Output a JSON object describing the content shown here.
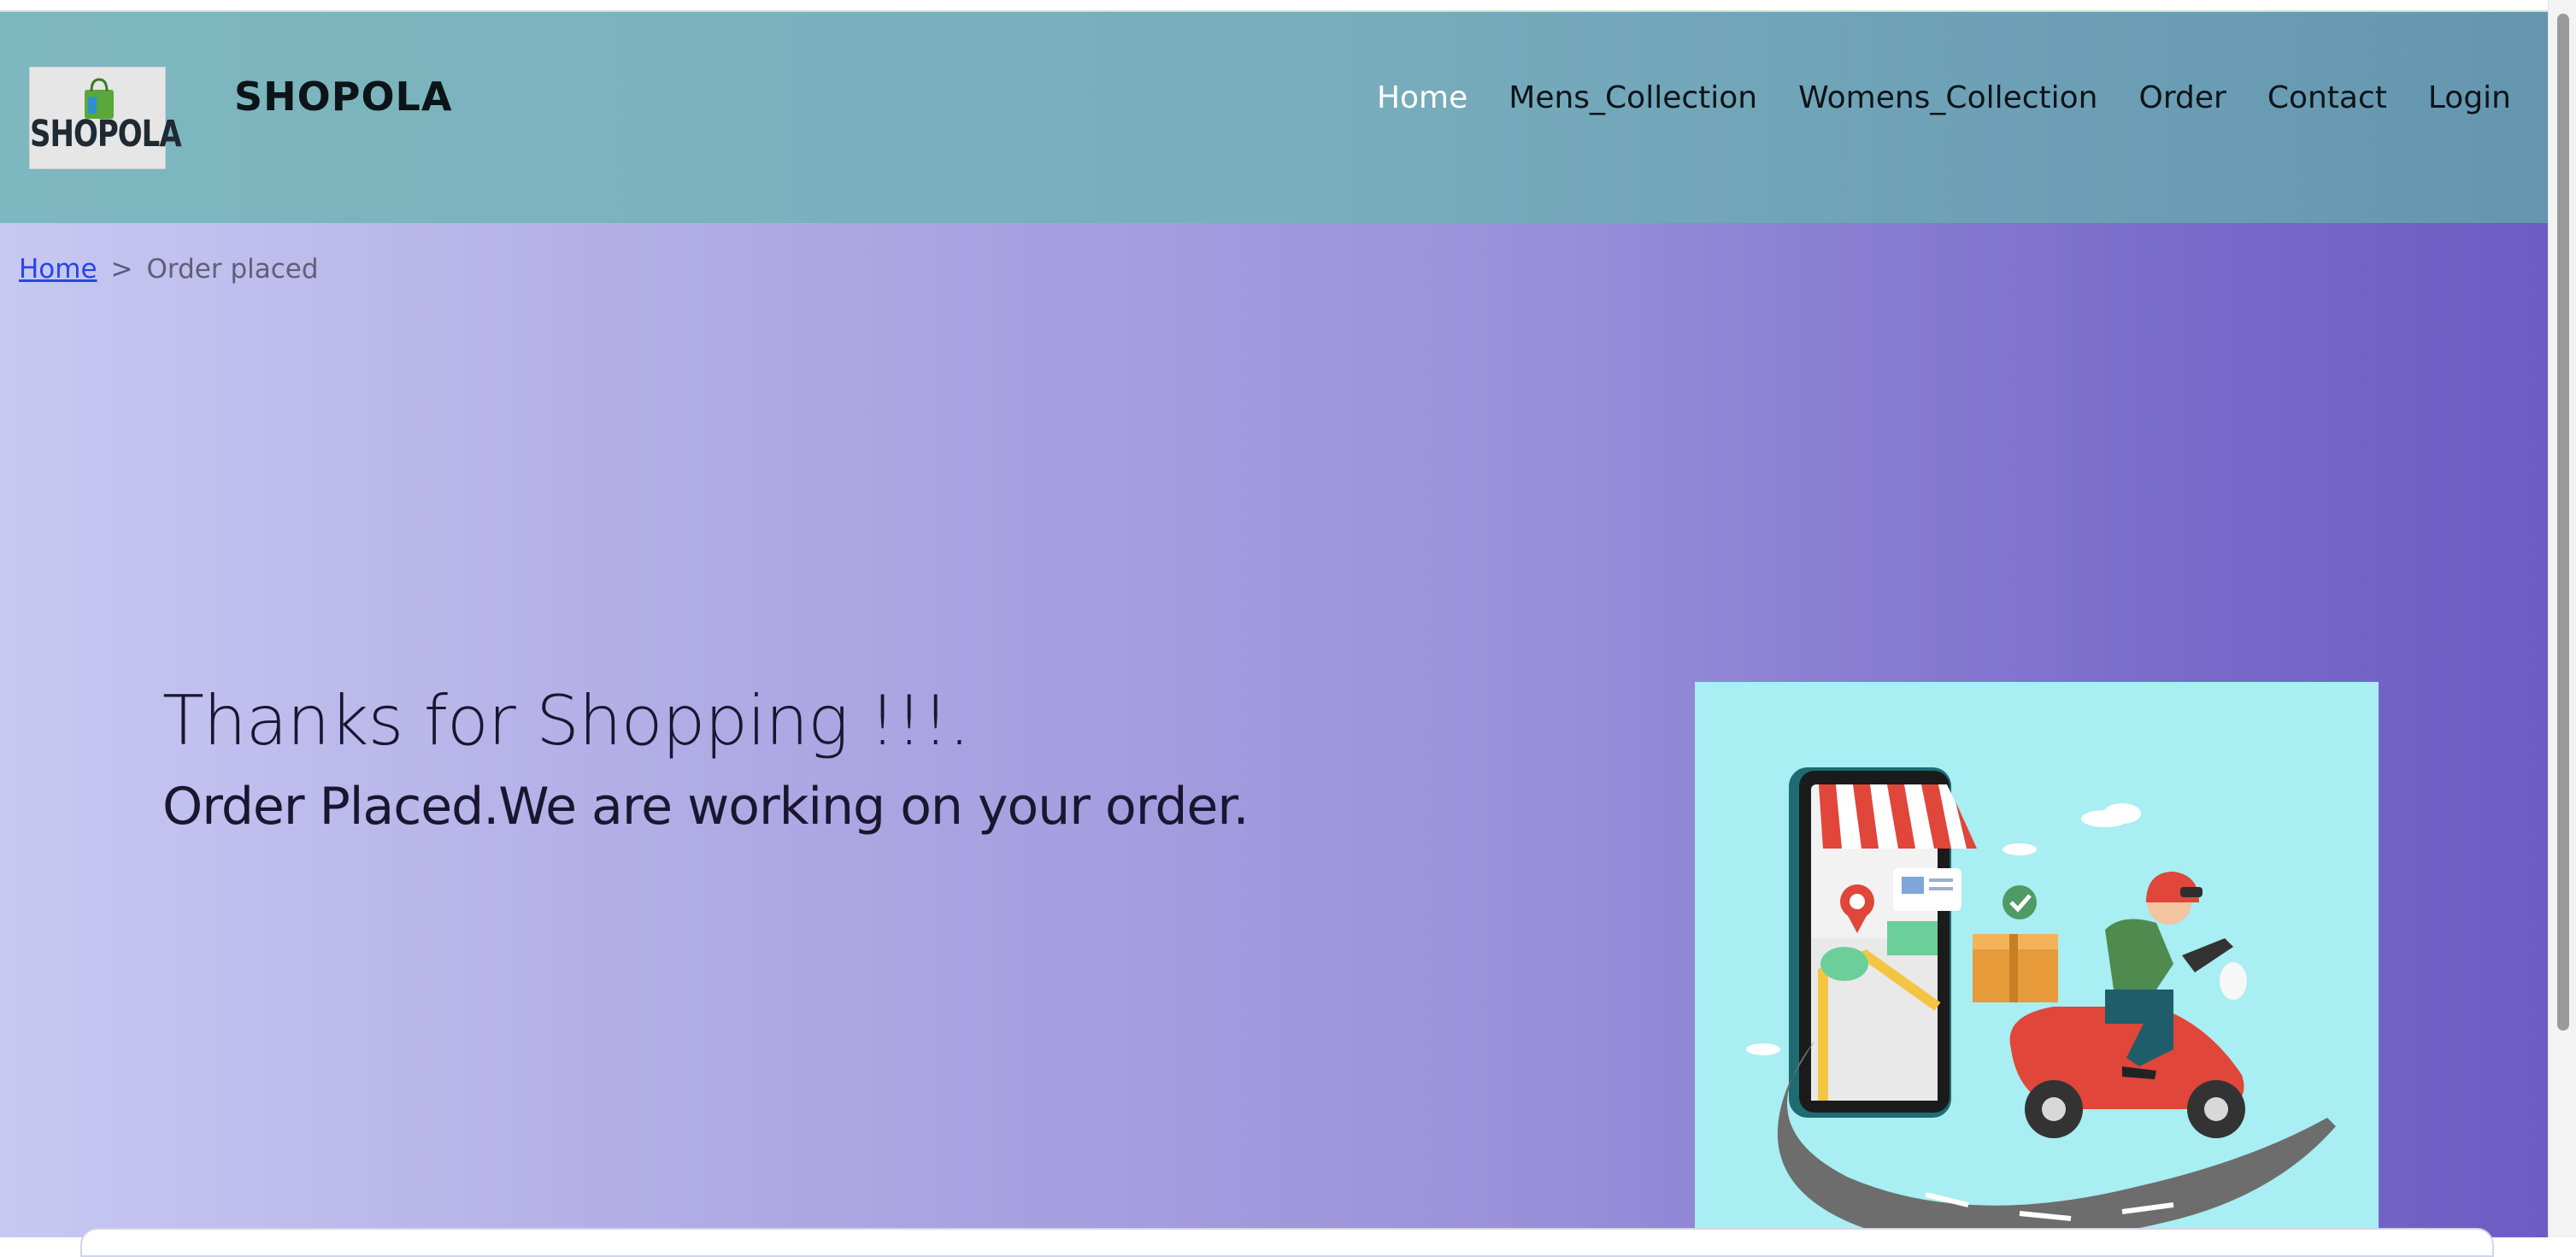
{
  "header": {
    "logo_text": "SHOPOLA",
    "brand": "SHOPOLA",
    "nav": [
      {
        "label": "Home",
        "active": true
      },
      {
        "label": "Mens_Collection",
        "active": false
      },
      {
        "label": "Womens_Collection",
        "active": false
      },
      {
        "label": "Order",
        "active": false
      },
      {
        "label": "Contact",
        "active": false
      },
      {
        "label": "Login",
        "active": false
      }
    ]
  },
  "breadcrumb": {
    "home": "Home",
    "separator": ">",
    "current": "Order placed"
  },
  "content": {
    "title": "Thanks for Shopping !!!.",
    "subtitle": "Order Placed.We are working on your order."
  },
  "illustration": {
    "icon": "delivery-scooter-phone-illustration"
  },
  "colors": {
    "header_start": "#7db7bf",
    "header_end": "#6596b0",
    "main_start": "#c8c8f2",
    "main_end": "#6d5cc2",
    "link": "#2447e8",
    "active_nav": "#ffffff"
  }
}
